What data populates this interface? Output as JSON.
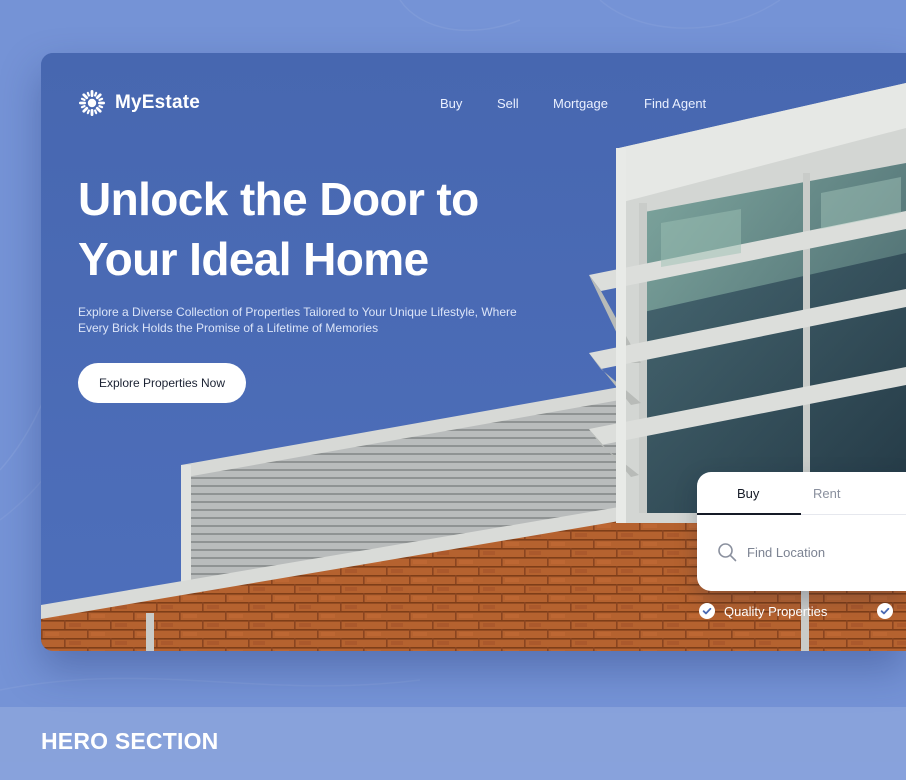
{
  "brand": {
    "name": "MyEstate",
    "icon": "sunburst-logo-icon"
  },
  "nav": {
    "items": [
      "Buy",
      "Sell",
      "Mortgage",
      "Find Agent"
    ]
  },
  "hero": {
    "title_line1": "Unlock the Door to",
    "title_line2": "Your Ideal Home",
    "subtitle_line1": "Explore a Diverse Collection of Properties Tailored to Your Unique Lifestyle, Where",
    "subtitle_line2": "Every Brick Holds the Promise of a Lifetime of Memories",
    "cta_label": "Explore Properties Now"
  },
  "search": {
    "tabs": [
      "Buy",
      "Rent"
    ],
    "active_tab": "Buy",
    "placeholder": "Find Location",
    "icon": "search-icon"
  },
  "features": {
    "items": [
      "Quality Properties",
      ""
    ]
  },
  "footer": {
    "label": "HERO SECTION"
  },
  "colors": {
    "page_bg": "#7593d6",
    "sky": "#4a6ab3",
    "brick": "#b5622f",
    "accent_text": "#ffffff"
  }
}
